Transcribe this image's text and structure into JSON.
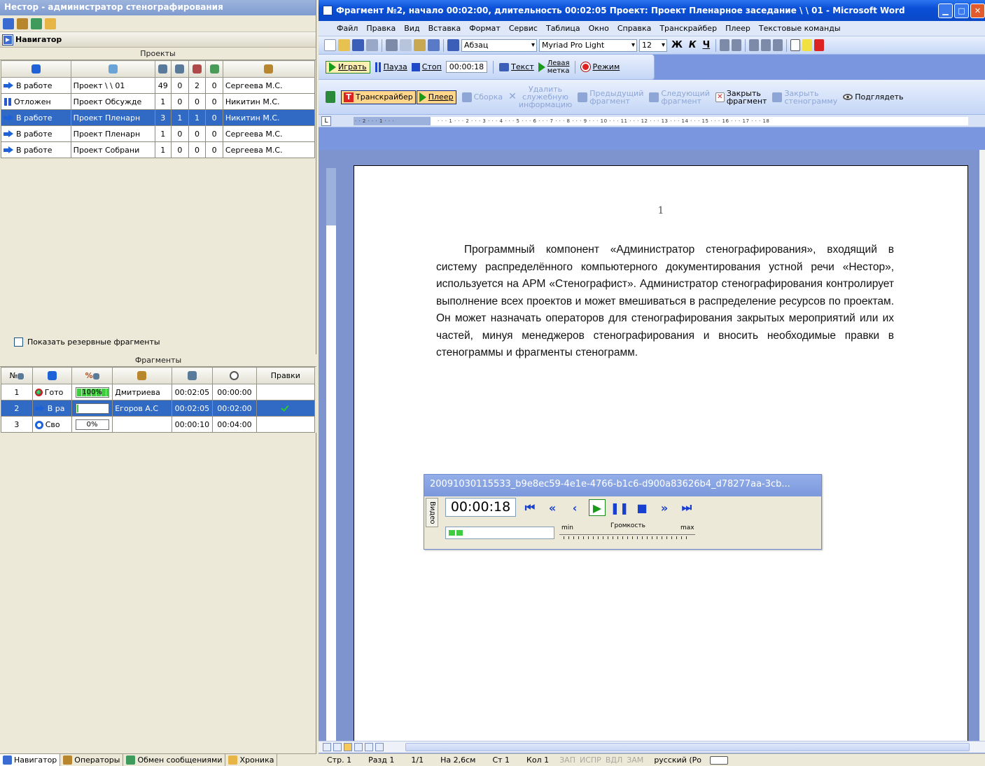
{
  "left_app": {
    "title": "Нестор - администратор стенографирования",
    "navigator_title": "Навигатор",
    "projects": {
      "caption": "Проекты",
      "rows": [
        {
          "status": "В работе",
          "project": "Проект \\ \\ 01",
          "c1": "49",
          "c2": "0",
          "c3": "2",
          "c4": "0",
          "manager": "Сергеева М.С.",
          "icon": "arrow-right-icon",
          "selected": false
        },
        {
          "status": "Отложен",
          "project": "Проект Обсужде",
          "c1": "1",
          "c2": "0",
          "c3": "0",
          "c4": "0",
          "manager": "Никитин М.С.",
          "icon": "pause-icon",
          "selected": false
        },
        {
          "status": "В работе",
          "project": "Проект Пленарн",
          "c1": "3",
          "c2": "1",
          "c3": "1",
          "c4": "0",
          "manager": "Никитин М.С.",
          "icon": "arrow-right-icon",
          "selected": true
        },
        {
          "status": "В работе",
          "project": "Проект Пленарн",
          "c1": "1",
          "c2": "0",
          "c3": "0",
          "c4": "0",
          "manager": "Сергеева М.С.",
          "icon": "arrow-right-icon",
          "selected": false
        },
        {
          "status": "В работе",
          "project": "Проект Собрани",
          "c1": "1",
          "c2": "0",
          "c3": "0",
          "c4": "0",
          "manager": "Сергеева М.С.",
          "icon": "arrow-right-icon",
          "selected": false
        }
      ]
    },
    "show_reserve_label": "Показать резервные фрагменты",
    "fragments": {
      "caption": "Фрагменты",
      "col_num": "№",
      "col_percent": "%",
      "col_edits": "Правки",
      "rows": [
        {
          "num": "1",
          "status": "Гото",
          "percent": "100%",
          "percent_value": 100,
          "operator": "Дмитриева",
          "duration": "00:02:05",
          "start": "00:00:00",
          "edits": "",
          "selected": false
        },
        {
          "num": "2",
          "status": "В ра",
          "percent": "",
          "percent_value": 5,
          "operator": "Егоров А.С",
          "duration": "00:02:05",
          "start": "00:02:00",
          "edits": "check",
          "selected": true
        },
        {
          "num": "3",
          "status": "Сво",
          "percent": "0%",
          "percent_value": 0,
          "operator": "",
          "duration": "00:00:10",
          "start": "00:04:00",
          "edits": "",
          "selected": false
        }
      ]
    },
    "bottom_tabs": [
      "Навигатор",
      "Операторы",
      "Обмен сообщениями",
      "Хроника"
    ]
  },
  "word": {
    "title": "Фрагмент №2, начало 00:02:00, длительность 00:02:05 Проект: Проект Пленарное заседание \\ \\ 01 - Microsoft Word",
    "menu": [
      "Файл",
      "Правка",
      "Вид",
      "Вставка",
      "Формат",
      "Сервис",
      "Таблица",
      "Окно",
      "Справка",
      "Транскрайбер",
      "Плеер",
      "Текстовые команды"
    ],
    "style_combo": "Абзац",
    "font_combo": "Myriad Pro Light",
    "size_combo": "12",
    "player_toolbar": {
      "play": "Играть",
      "pause": "Пауза",
      "stop": "Стоп",
      "time": "00:00:18",
      "text": "Текст",
      "left_mark_1": "Левая",
      "left_mark_2": "метка",
      "mode": "Режим"
    },
    "transcriber_toolbar": {
      "transcriber": "Транскрайбер",
      "player": "Плеер",
      "assembly": "Сборка",
      "delete_service_1": "Удалить",
      "delete_service_2": "служебную",
      "delete_service_3": "информацию",
      "prev_1": "Предыдущий",
      "prev_2": "фрагмент",
      "next_1": "Следующий",
      "next_2": "фрагмент",
      "close_frag_1": "Закрыть",
      "close_frag_2": "фрагмент",
      "close_steno_1": "Закрыть",
      "close_steno_2": "стенограмму",
      "peek": "Подглядеть"
    },
    "page_number": "1",
    "body_text": "Программный компонент «Администратор стенографирования», входящий в систему распределённого компьютерного документирования устной речи «Нестор», используется на АРМ «Стенографист». Администратор стенографирования контролирует выполнение всех проектов и может вмешиваться в распределение ресурсов по проектам. Он может назначать операторов для стенографирования закрытых мероприятий или их частей, минуя менеджеров стенографирования и вносить необходимые правки в стенограммы и фрагменты стенограмм.",
    "status": {
      "page": "Стр. 1",
      "section": "Разд 1",
      "pages": "1/1",
      "at": "На 2,6см",
      "line": "Ст 1",
      "col": "Кол 1",
      "rec": "ЗАП",
      "trk": "ИСПР",
      "ext": "ВДЛ",
      "ovr": "ЗАМ",
      "lang": "русский (Ро"
    }
  },
  "media_player": {
    "title": "20091030115533_b9e8ec59-4e1e-4766-b1c6-d900a83626b4_d78277aa-3cb...",
    "side_label": "Видео",
    "time": "00:00:18",
    "vol_min": "min",
    "vol_title": "Громкость",
    "vol_max": "max"
  }
}
